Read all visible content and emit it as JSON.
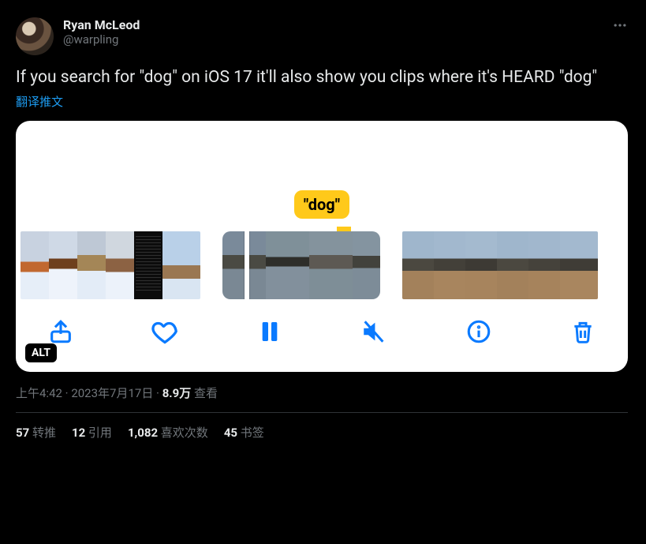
{
  "user": {
    "display_name": "Ryan McLeod",
    "handle": "@warpling"
  },
  "tweet": {
    "text": "If you search for \"dog\" on iOS 17 it'll also show you clips where it's HEARD \"dog\"",
    "translate_label": "翻译推文"
  },
  "media": {
    "caption_pill": "\"dog\"",
    "alt_label": "ALT"
  },
  "meta": {
    "time": "上午4:42",
    "date": "2023年7月17日",
    "views_count": "8.9万",
    "views_label": "查看",
    "separator": " · "
  },
  "stats": {
    "retweets_count": "57",
    "retweets_label": "转推",
    "quotes_count": "12",
    "quotes_label": "引用",
    "likes_count": "1,082",
    "likes_label": "喜欢次数",
    "bookmarks_count": "45",
    "bookmarks_label": "书签"
  }
}
